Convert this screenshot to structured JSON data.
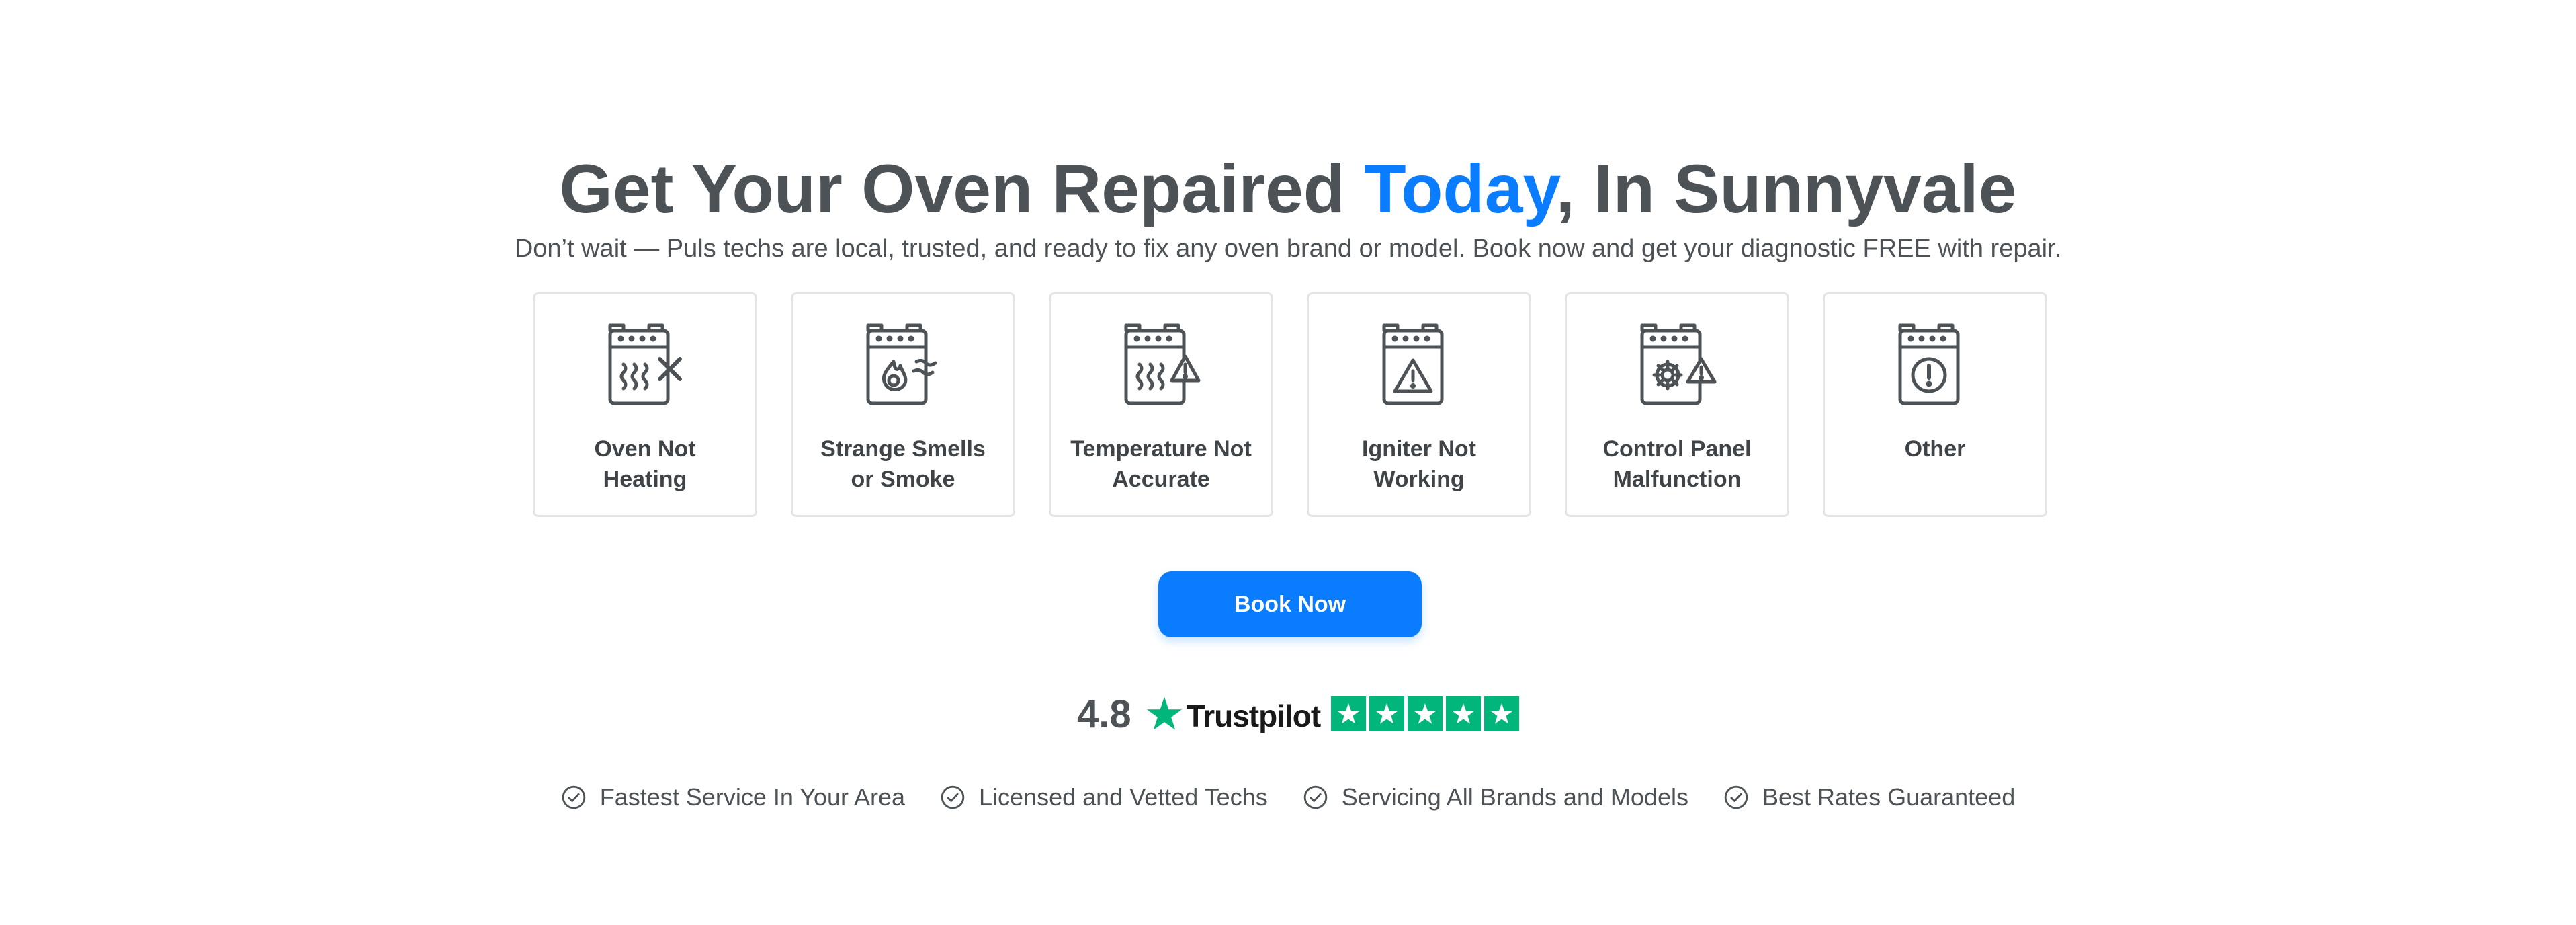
{
  "hero": {
    "title_part1": "Get Your Oven Repaired ",
    "title_highlight": "Today",
    "title_part2": ", In Sunnyvale",
    "subtitle": "Don’t wait — Puls techs are local, trusted, and ready to fix any oven brand or model. Book now and get your diagnostic FREE with repair."
  },
  "issues": [
    {
      "label": "Oven Not Heating",
      "icon": "oven-heat-x-icon"
    },
    {
      "label": "Strange Smells or Smoke",
      "icon": "oven-flame-smell-icon"
    },
    {
      "label": "Temperature Not Accurate",
      "icon": "oven-heat-warning-icon"
    },
    {
      "label": "Igniter Not Working",
      "icon": "oven-warning-icon"
    },
    {
      "label": "Control Panel Malfunction",
      "icon": "oven-gear-warning-icon"
    },
    {
      "label": "Other",
      "icon": "oven-exclamation-icon"
    }
  ],
  "cta": {
    "label": "Book Now"
  },
  "rating": {
    "value": "4.8",
    "brand": "Trustpilot",
    "stars": 5
  },
  "features": [
    "Fastest Service In Your Area",
    "Licensed and Vetted Techs",
    "Servicing All Brands and Models",
    "Best Rates Guaranteed"
  ],
  "colors": {
    "accent": "#0a7cff",
    "text": "#4c5256",
    "trustpilot_green": "#00b67a"
  }
}
